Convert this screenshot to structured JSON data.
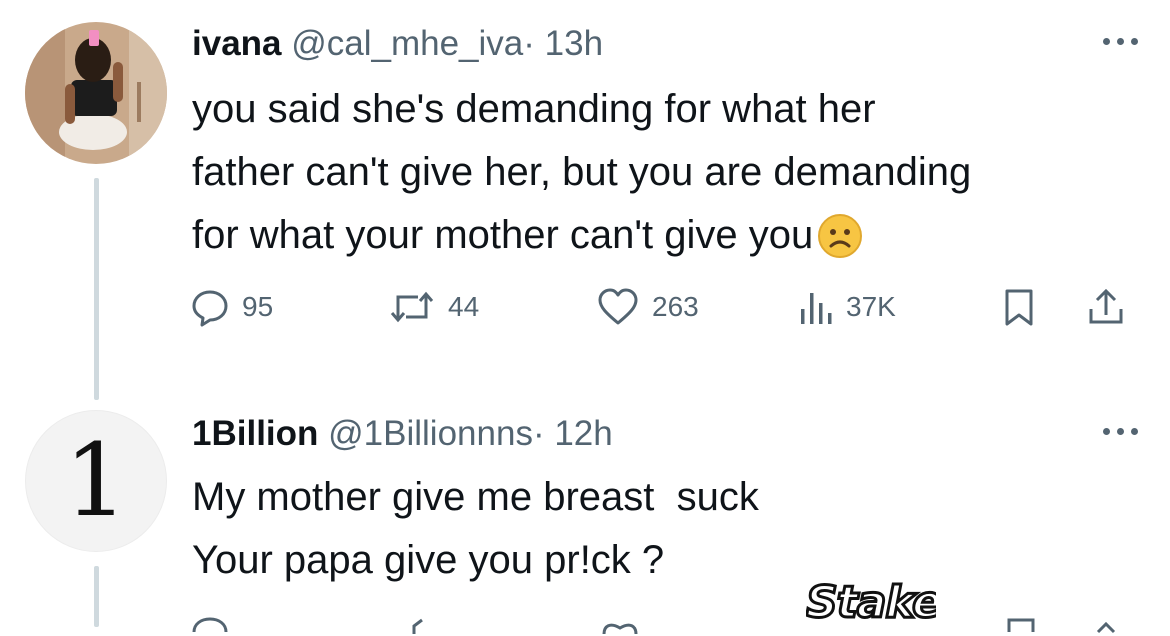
{
  "tweets": [
    {
      "name": "ivana",
      "handle": "@cal_mhe_iva",
      "separator": "·",
      "time": "13h",
      "text_lines": [
        "you said she's demanding for what her",
        "father can't give her, but you are demanding",
        "for what your mother can't give you"
      ],
      "emoji": "frowning-face",
      "replies": "95",
      "reposts": "44",
      "likes": "263",
      "views": "37K"
    },
    {
      "name": "1Billion",
      "handle": "@1Billionnns",
      "separator": "·",
      "time": "12h",
      "avatar_text": "1",
      "text_lines": [
        "My mother give me breast  suck",
        "Your papa give you pr!ck ?"
      ]
    }
  ],
  "watermark": "Stake",
  "colors": {
    "text": "#0f1419",
    "secondary": "#536471",
    "thread_line": "#cfd9de",
    "emoji": "#f7c543"
  }
}
